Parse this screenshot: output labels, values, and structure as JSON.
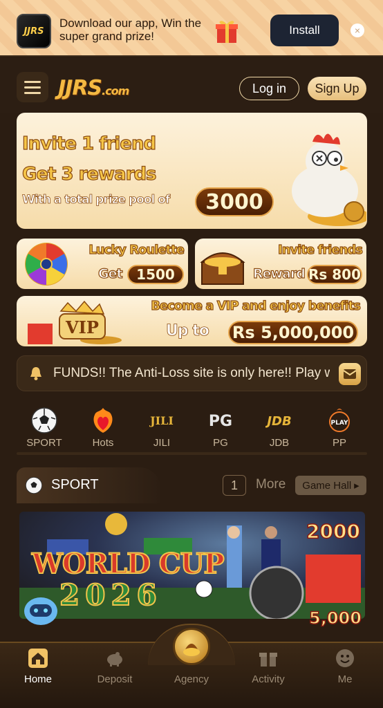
{
  "promo": {
    "text": "Download our app, Win the super grand prize!",
    "install_label": "Install",
    "close_label": "×",
    "app_logo_text": "JJRS"
  },
  "header": {
    "logo_text": "JJRS",
    "logo_suffix": ".com",
    "login_label": "Log in",
    "signup_label": "Sign Up"
  },
  "hero": {
    "line1": "Invite 1 friend",
    "line2": "Get 3 rewards",
    "line3": "With a total prize pool of",
    "amount": "3000"
  },
  "roulette": {
    "title": "Lucky Roulette",
    "label": "Get",
    "amount": "1500"
  },
  "invite": {
    "title": "Invite friends",
    "label": "Reward",
    "amount": "Rs 800"
  },
  "vip": {
    "badge": "VIP",
    "title": "Become a VIP and enjoy benefits",
    "label": "Up to",
    "amount": "Rs 5,000,000"
  },
  "marquee": {
    "text": "FUNDS!! The Anti-Loss site is only here!! Play w"
  },
  "categories": [
    {
      "label": "SPORT",
      "icon": "soccer-ball-icon"
    },
    {
      "label": "Hots",
      "icon": "flame-heart-icon"
    },
    {
      "label": "JILI",
      "icon": "jili-logo-icon"
    },
    {
      "label": "PG",
      "icon": "pg-logo-icon"
    },
    {
      "label": "JDB",
      "icon": "jdb-logo-icon"
    },
    {
      "label": "PP",
      "icon": "pp-play-icon"
    }
  ],
  "category_logos": {
    "jili": "JILI",
    "pg": "PG",
    "jdb": "JDB",
    "pp": "PLAY"
  },
  "sport_section": {
    "title": "SPORT",
    "page": "1",
    "more_label": "More",
    "game_hall_label": "Game Hall",
    "banner_title": "WORLD CUP",
    "banner_year": "2026",
    "badge_top": "2000",
    "badge_bottom": "5,000"
  },
  "bottom_nav": [
    {
      "label": "Home",
      "active": true
    },
    {
      "label": "Deposit",
      "active": false
    },
    {
      "label": "Agency",
      "active": false
    },
    {
      "label": "Activity",
      "active": false
    },
    {
      "label": "Me",
      "active": false
    }
  ],
  "colors": {
    "background": "#2b1d12",
    "accent_gold": "#f6c648",
    "card_bg": "#fdf2dc",
    "pill_brown": "#7a3a0a"
  }
}
